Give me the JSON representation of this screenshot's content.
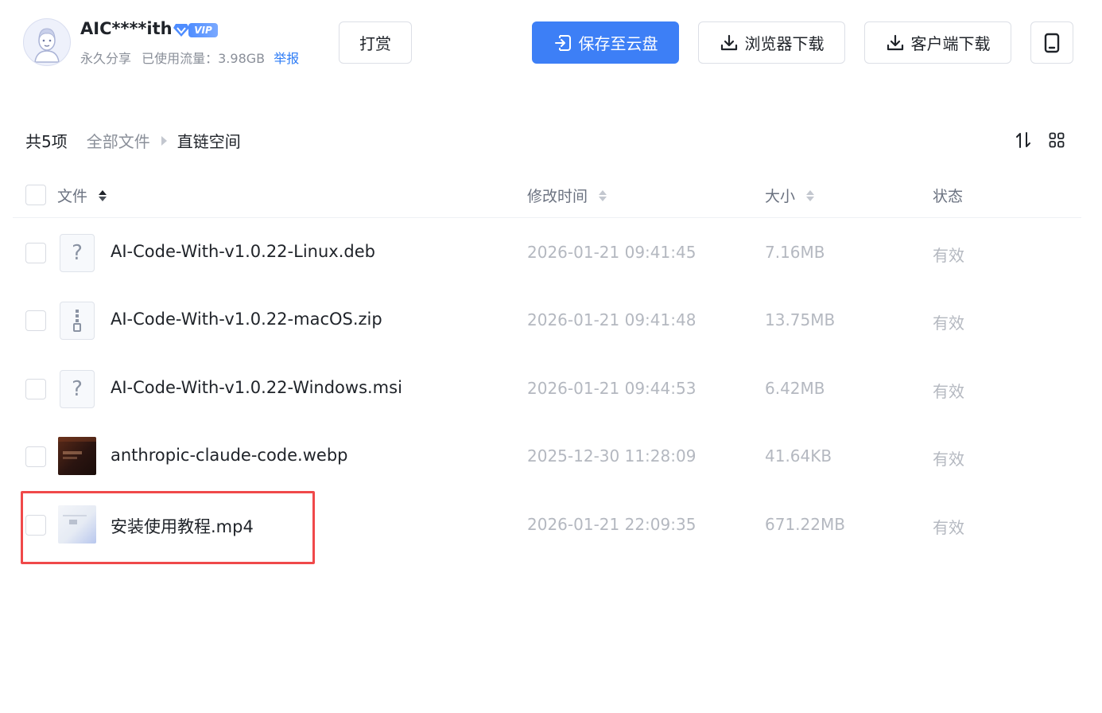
{
  "user": {
    "name": "AIC****ith",
    "vip_label": "VIP",
    "share_type": "永久分享",
    "traffic_label": "已使用流量：",
    "traffic_value": "3.98GB",
    "report_label": "举报"
  },
  "toolbar": {
    "tip_label": "打赏",
    "save_label": "保存至云盘",
    "browser_download_label": "浏览器下载",
    "client_download_label": "客户端下载"
  },
  "breadcrumb": {
    "count": "共5项",
    "all_files": "全部文件",
    "current": "直链空间"
  },
  "table": {
    "headers": {
      "file": "文件",
      "time": "修改时间",
      "size": "大小",
      "status": "状态"
    },
    "rows": [
      {
        "name": "AI-Code-With-v1.0.22-Linux.deb",
        "time": "2026-01-21 09:41:45",
        "size": "7.16MB",
        "status": "有效",
        "icon": "unknown-file-icon"
      },
      {
        "name": "AI-Code-With-v1.0.22-macOS.zip",
        "time": "2026-01-21 09:41:48",
        "size": "13.75MB",
        "status": "有效",
        "icon": "zip-file-icon"
      },
      {
        "name": "AI-Code-With-v1.0.22-Windows.msi",
        "time": "2026-01-21 09:44:53",
        "size": "6.42MB",
        "status": "有效",
        "icon": "unknown-file-icon"
      },
      {
        "name": "anthropic-claude-code.webp",
        "time": "2025-12-30 11:28:09",
        "size": "41.64KB",
        "status": "有效",
        "icon": "image-thumbnail"
      },
      {
        "name": "安装使用教程.mp4",
        "time": "2026-01-21 22:09:35",
        "size": "671.22MB",
        "status": "有效",
        "icon": "video-thumbnail"
      }
    ]
  },
  "colors": {
    "primary": "#3d7ff6",
    "highlight": "#f0494a",
    "muted_text": "#b4b8c0"
  }
}
